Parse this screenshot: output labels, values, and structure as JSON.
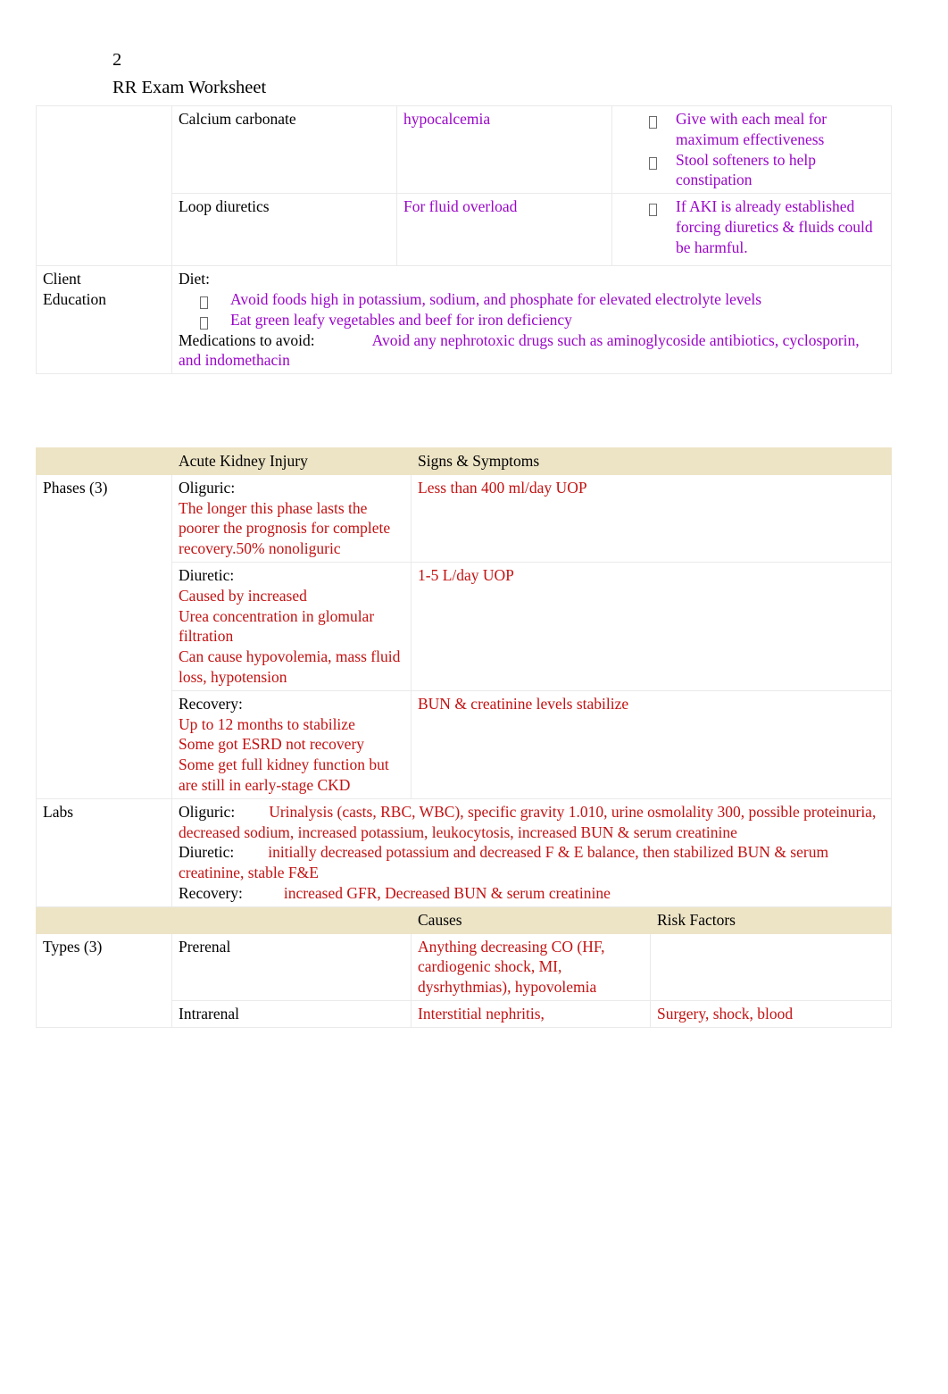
{
  "header": {
    "page_number": "2",
    "title": "RR Exam Worksheet"
  },
  "colors": {
    "purple_text": "#9A06C9",
    "red_text": "#C31212",
    "header_band": "#EDE4C6",
    "border": "#EAEAEA"
  },
  "table1": {
    "rows": [
      {
        "label": "",
        "drug": "Calcium carbonate",
        "indication": "hypocalcemia",
        "notes": [
          "Give with each meal for maximum effectiveness",
          "Stool softeners to help constipation"
        ]
      },
      {
        "label": "",
        "drug": "Loop diuretics",
        "indication": "For fluid overload",
        "notes": [
          "If AKI is already established forcing diuretics & fluids could be harmful."
        ]
      }
    ],
    "client_education": {
      "label_line1": "Client",
      "label_line2": "Education",
      "diet_heading": "Diet:",
      "diet_bullets": [
        "Avoid foods high in potassium, sodium, and phosphate for elevated electrolyte levels",
        "Eat green leafy vegetables and beef for iron deficiency"
      ],
      "meds_label": "Medications to avoid:",
      "meds_value": "Avoid any nephrotoxic drugs such as aminoglycoside antibiotics, cyclosporin, and indomethacin"
    }
  },
  "table2": {
    "header_row_1": {
      "col1": "",
      "col2": "Acute Kidney Injury",
      "col3": "Signs & Symptoms",
      "col4": ""
    },
    "phases": {
      "label": "Phases (3)",
      "items": [
        {
          "name": "Oliguric:",
          "detail": "The longer this phase lasts the poorer the prognosis for complete recovery.50% nonoliguric",
          "signs": "Less than 400 ml/day UOP"
        },
        {
          "name": "Diuretic:",
          "detail_lines": [
            "Caused by increased",
            "Urea concentration in glomular filtration",
            "Can cause hypovolemia, mass fluid loss, hypotension"
          ],
          "signs": "1-5 L/day UOP"
        },
        {
          "name": "Recovery:",
          "detail_lines": [
            "Up to 12 months to stabilize",
            "Some got ESRD not recovery",
            "Some get full kidney function but are still in early-stage CKD"
          ],
          "signs": "BUN & creatinine levels stabilize"
        }
      ]
    },
    "labs": {
      "label": "Labs",
      "entries": [
        {
          "name": "Oliguric:",
          "value": "Urinalysis (casts, RBC, WBC), specific gravity 1.010, urine osmolality 300, possible proteinuria, decreased sodium, increased potassium, leukocytosis, increased BUN & serum creatinine"
        },
        {
          "name": "Diuretic:",
          "value": "initially decreased potassium and decreased F & E balance, then stabilized BUN & serum creatinine, stable F&E"
        },
        {
          "name": "Recovery:",
          "value": "increased GFR, Decreased BUN & serum creatinine"
        }
      ]
    },
    "header_row_2": {
      "col1": "",
      "col2": "",
      "col3": "Causes",
      "col4": "Risk Factors"
    },
    "types": {
      "label": "Types (3)",
      "items": [
        {
          "name": "Prerenal",
          "causes": "Anything decreasing CO (HF, cardiogenic shock, MI, dysrhythmias), hypovolemia",
          "risk_factors": ""
        },
        {
          "name": "Intrarenal",
          "causes": "Interstitial nephritis,",
          "risk_factors": "Surgery, shock, blood"
        }
      ]
    }
  }
}
